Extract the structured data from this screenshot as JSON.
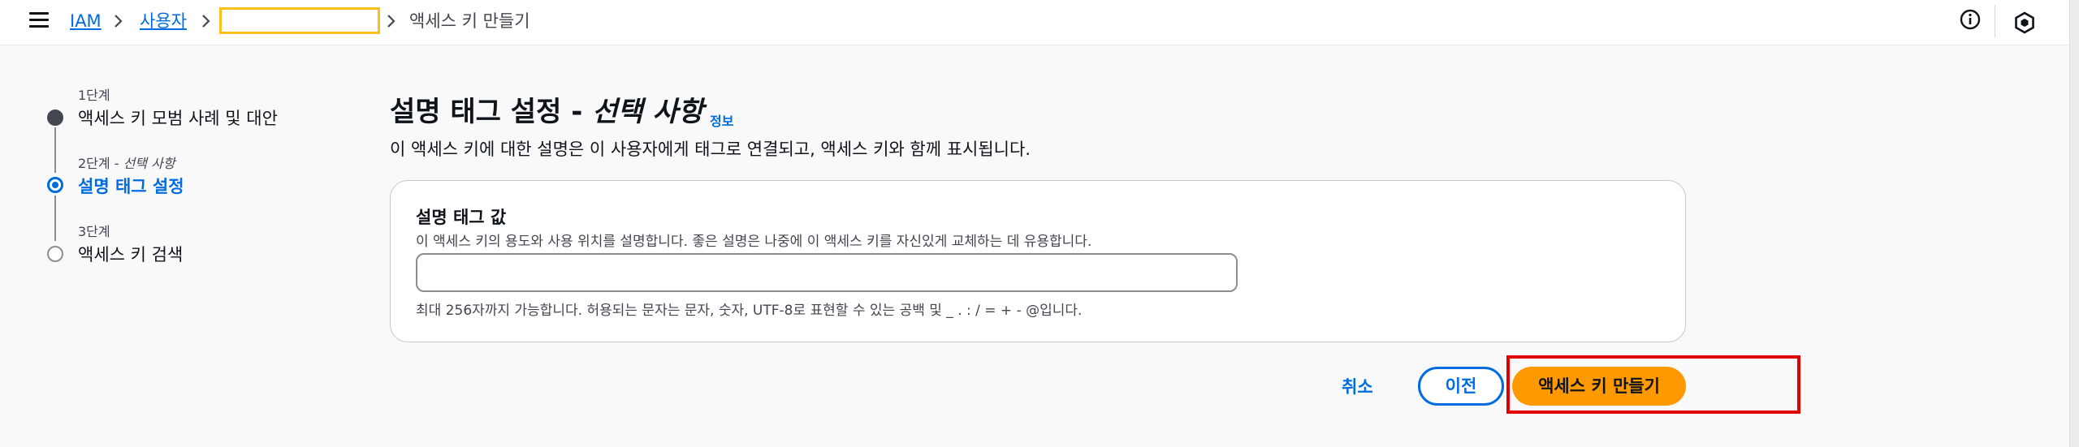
{
  "header": {
    "breadcrumb": [
      "IAM",
      "사용자",
      "액세스 키 만들기"
    ]
  },
  "steps": [
    {
      "num": "1단계",
      "title": "액세스 키 모범 사례 및 대안"
    },
    {
      "num": "2단계 - ",
      "optional": "선택 사항",
      "title": "설명 태그 설정"
    },
    {
      "num": "3단계",
      "title": "액세스 키 검색"
    }
  ],
  "main": {
    "title": "설명 태그 설정 - ",
    "title_italic": "선택 사항",
    "info_link": "정보",
    "description": "이 액세스 키에 대한 설명은 이 사용자에게 태그로 연결되고, 액세스 키와 함께 표시됩니다.",
    "field_label": "설명 태그 값",
    "field_description": "이 액세스 키의 용도와 사용 위치를 설명합니다. 좋은 설명은 나중에 이 액세스 키를 자신있게 교체하는 데 유용합니다.",
    "field_value": "",
    "field_hint": "최대 256자까지 가능합니다. 허용되는 문자는 문자, 숫자, UTF-8로 표현할 수 있는 공백 및 _ . : / = + - @입니다."
  },
  "actions": {
    "cancel": "취소",
    "previous": "이전",
    "create": "액세스 키 만들기"
  },
  "colors": {
    "accent": "#006ce0",
    "primary_button": "#ff9900",
    "highlight_box": "#ffbf1a",
    "annotation_box": "#e00000"
  },
  "icons": [
    "menu-icon",
    "chevron-right-icon",
    "info-icon",
    "hexagon-icon"
  ]
}
